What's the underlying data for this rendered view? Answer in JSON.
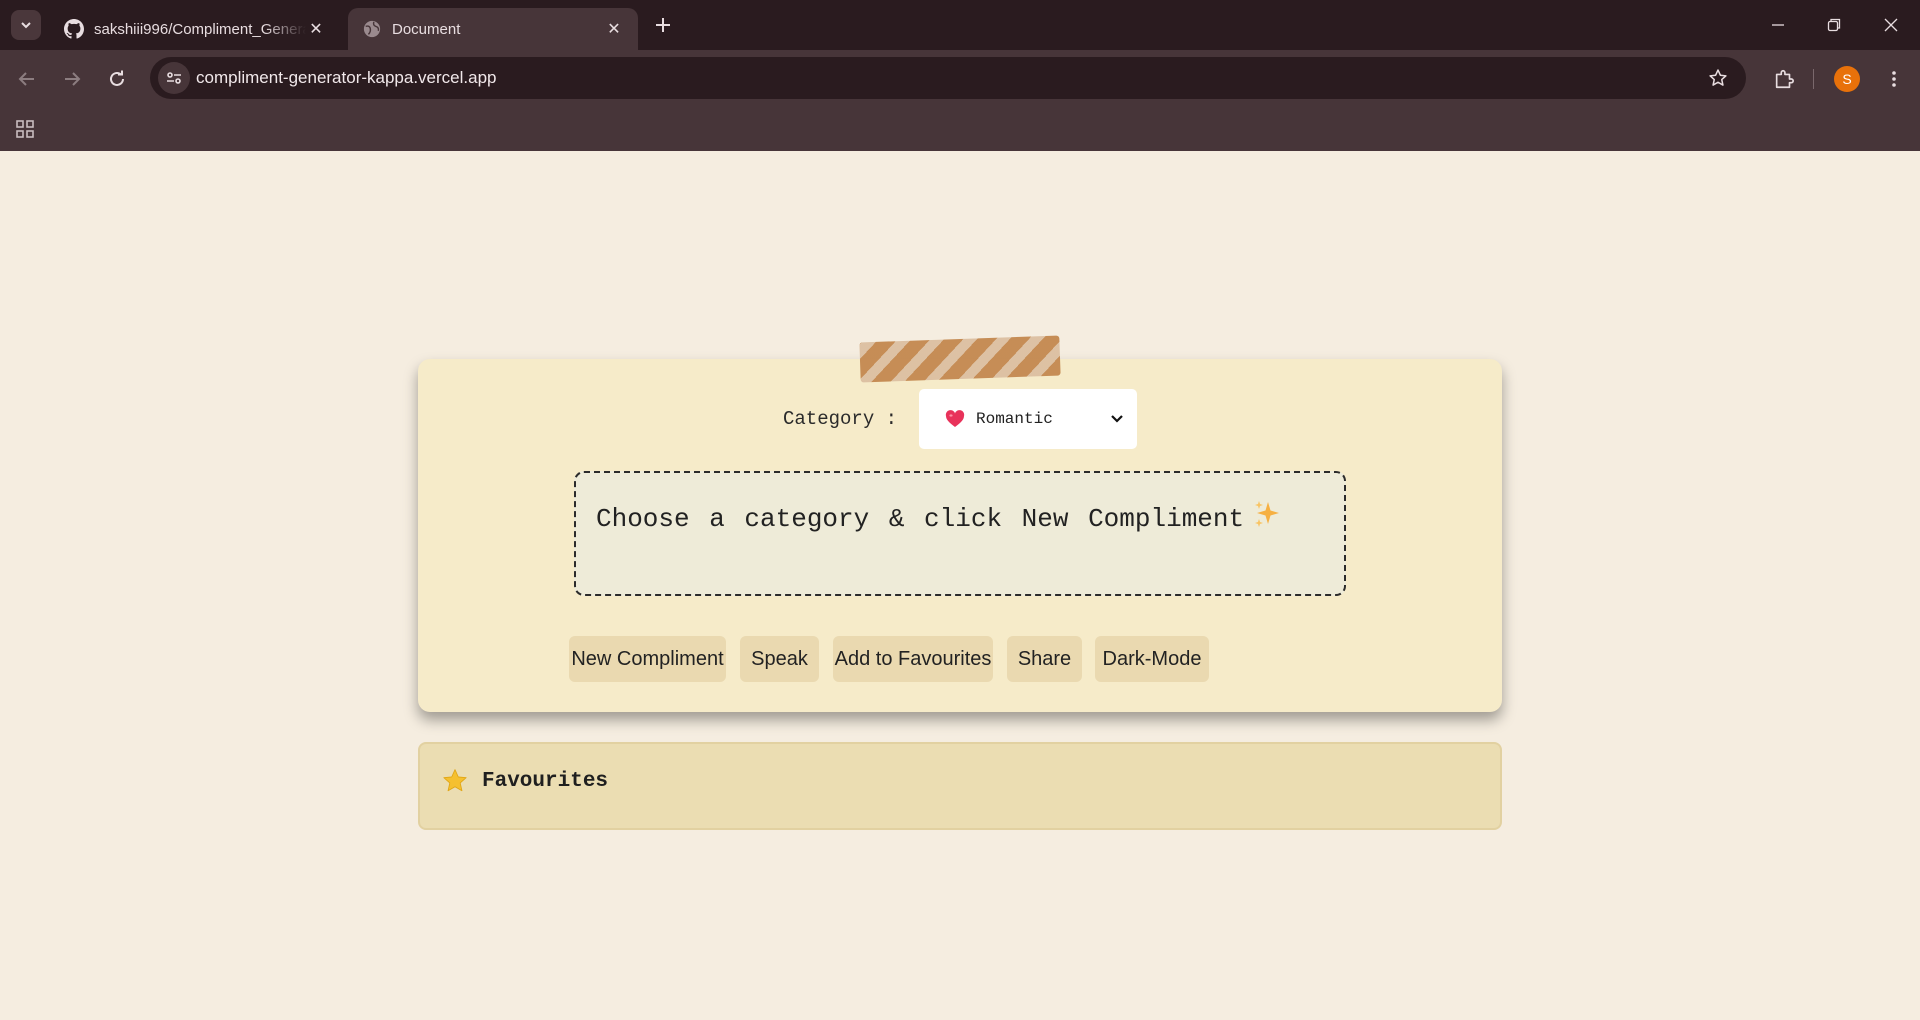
{
  "browser": {
    "tabs": [
      {
        "title": "sakshiii996/Compliment_Generator",
        "favicon": "github-icon",
        "active": false
      },
      {
        "title": "Document",
        "favicon": "globe-icon",
        "active": true
      }
    ],
    "url": "compliment-generator-kappa.vercel.app",
    "profile_initial": "S",
    "colors": {
      "tabstrip": "#2a1b1f",
      "toolbar": "#473539",
      "avatar": "#e8710a"
    }
  },
  "app": {
    "category_label": "Category :",
    "category_selected": "Romantic",
    "category_icon": "heart-icon",
    "compliment_text": "Choose a category & click New Compliment",
    "compliment_icon": "sparkles-icon",
    "buttons": {
      "new_compliment": "New Compliment",
      "speak": "Speak",
      "add_favourites": "Add to Favourites",
      "share": "Share",
      "dark_mode": "Dark-Mode"
    },
    "favourites_title": "Favourites",
    "favourites_icon": "star-icon",
    "colors": {
      "page_bg": "#f5ede0",
      "card_bg": "#f6ebc9",
      "button_bg": "#ead9b0",
      "favourites_bg": "#ebddb2",
      "tape": "#c48a52"
    }
  }
}
